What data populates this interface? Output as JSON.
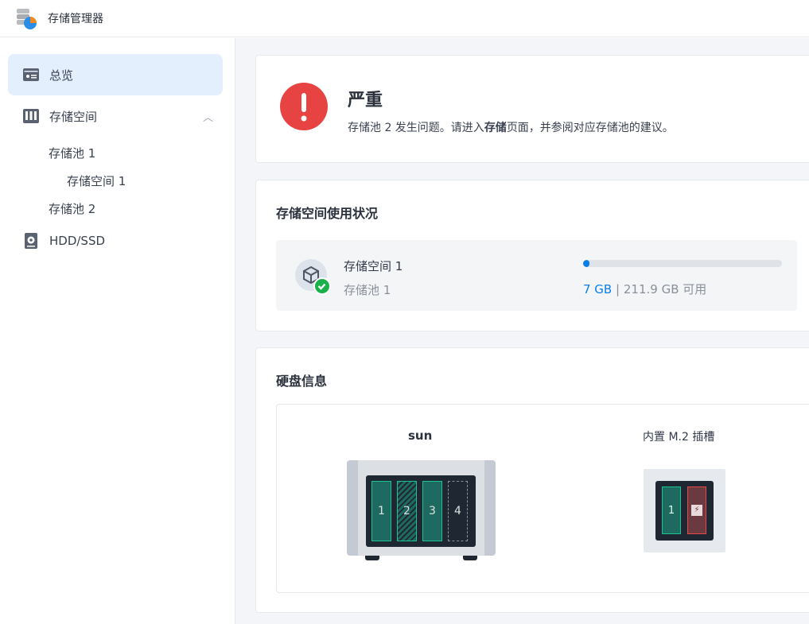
{
  "app": {
    "title": "存储管理器",
    "icon": "storage-manager-icon"
  },
  "sidebar": {
    "items": [
      {
        "label": "总览",
        "icon": "overview-icon"
      },
      {
        "label": "存储空间",
        "icon": "storage-icon"
      },
      {
        "label": "存储池 1"
      },
      {
        "label": "存储空间 1"
      },
      {
        "label": "存储池 2"
      },
      {
        "label": "HDD/SSD",
        "icon": "disk-icon"
      }
    ]
  },
  "alert": {
    "title": "严重",
    "msg_pre": "存储池 2 发生问题。请进入",
    "msg_bold": "存储",
    "msg_post": "页面，并参阅对应存储池的建议。",
    "color": "#e84343"
  },
  "usage": {
    "title": "存储空间使用状况",
    "volume": "存储空间 1",
    "pool": "存储池 1",
    "used": "7 GB",
    "sep": "|",
    "free": "211.9 GB 可用",
    "percent": 3.2,
    "accent": "#0a7ee8"
  },
  "disks": {
    "title": "硬盘信息",
    "unit_name": "sun",
    "slots": [
      "1",
      "2",
      "3",
      "4"
    ],
    "m2_title": "内置 M.2 插槽",
    "m2_slots": [
      "1"
    ]
  }
}
